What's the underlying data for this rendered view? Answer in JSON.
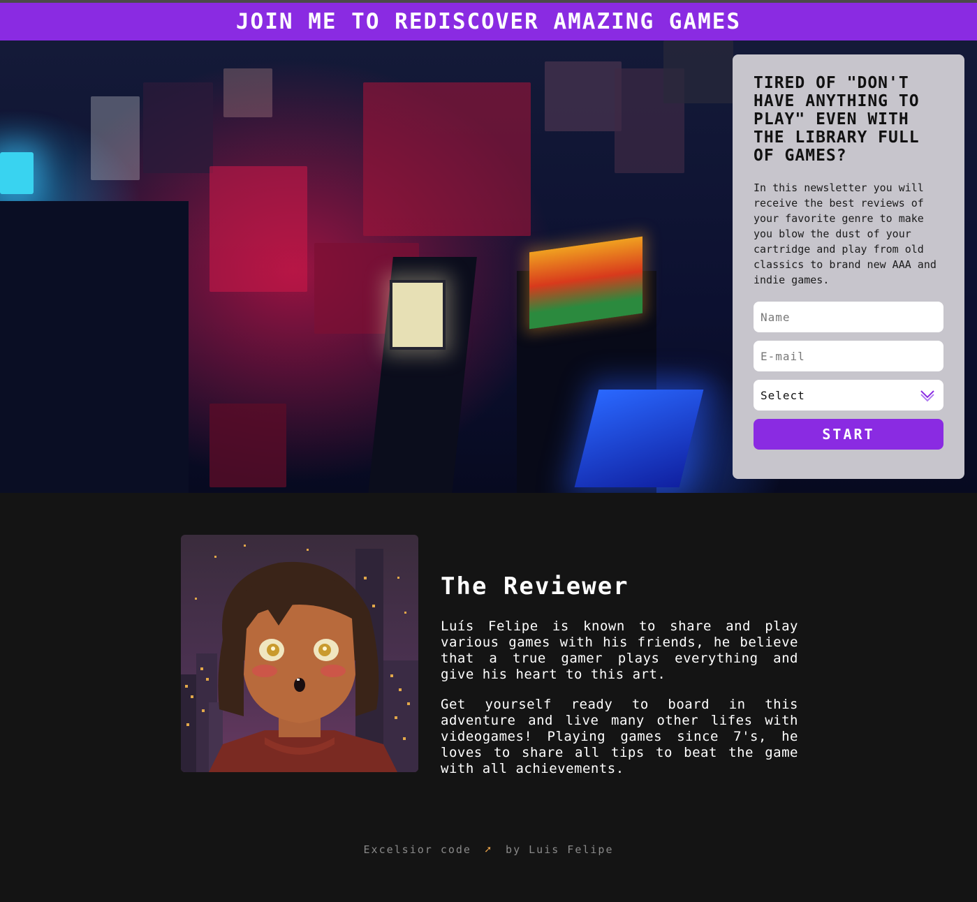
{
  "banner": {
    "title": "JOIN ME TO REDISCOVER AMAZING GAMES"
  },
  "signup": {
    "title": "TIRED OF \"DON'T HAVE ANYTHING TO PLAY\" EVEN WITH THE LIBRARY FULL OF GAMES?",
    "description": "In this newsletter you will receive the best reviews of your favorite genre to make you blow the dust of your cartridge and play from old classics to brand new AAA and indie games.",
    "name_placeholder": "Name",
    "email_placeholder": "E-mail",
    "select_value": "Select",
    "select_icon": "chevron-down-icon",
    "start_label": "START"
  },
  "about": {
    "title": "The Reviewer",
    "paragraph1": "Luís Felipe is known to share and play various games with his friends, he believe that a true gamer plays everything and give his heart to this art.",
    "paragraph2": "Get yourself ready to board in this adventure and live many other lifes with videogames! Playing games since 7's, he loves to share all tips to beat the game with all achievements."
  },
  "footer": {
    "left_text": "Excelsior code",
    "icon": "rocket-icon",
    "right_text": "by Luis Felipe"
  },
  "colors": {
    "accent": "#8a2be2",
    "page_background": "#141414",
    "card_background": "#c7c5cc"
  }
}
